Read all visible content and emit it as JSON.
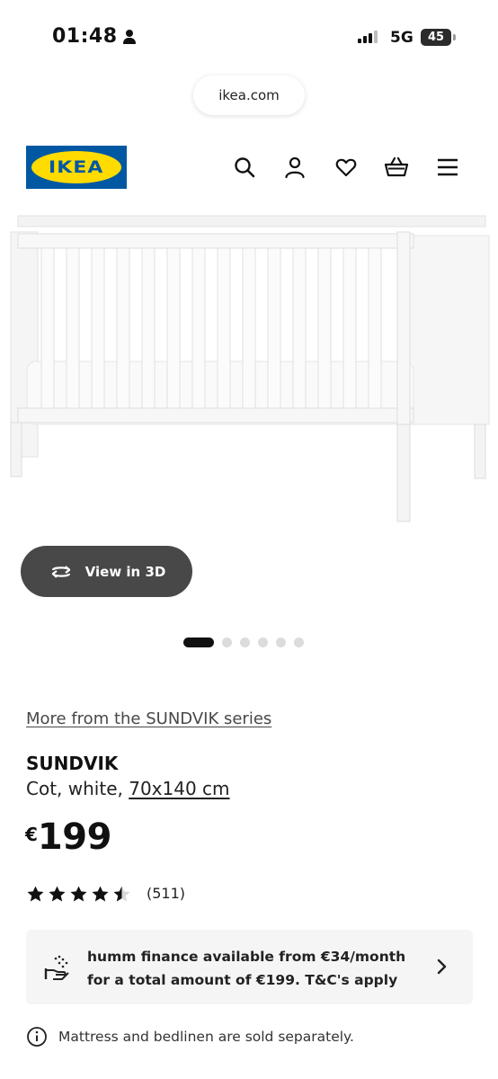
{
  "status_bar": {
    "time": "01:48",
    "network": "5G",
    "battery": "45"
  },
  "browser": {
    "url": "ikea.com"
  },
  "header": {
    "logo_text": "IKEA",
    "icons": [
      "search-icon",
      "account-icon",
      "favourites-icon",
      "basket-icon",
      "menu-icon"
    ]
  },
  "gallery": {
    "view_3d_label": "View in 3D",
    "dot_count": 6,
    "active_index": 0
  },
  "product": {
    "series_link": "More from the SUNDVIK series",
    "name": "SUNDVIK",
    "description": "Cot, white, ",
    "size_link": "70x140 cm",
    "currency": "€",
    "price": "199",
    "rating": 4.5,
    "review_count": "(511)"
  },
  "finance": {
    "line1": "humm finance available from €34/month",
    "line2": "for a total amount of €199. T&C's apply"
  },
  "note": "Mattress and bedlinen are sold separately.",
  "colors": {
    "brand_blue": "#0058a3",
    "brand_yellow": "#ffdb00",
    "button_dark": "#484848",
    "panel_bg": "#f5f5f5"
  }
}
